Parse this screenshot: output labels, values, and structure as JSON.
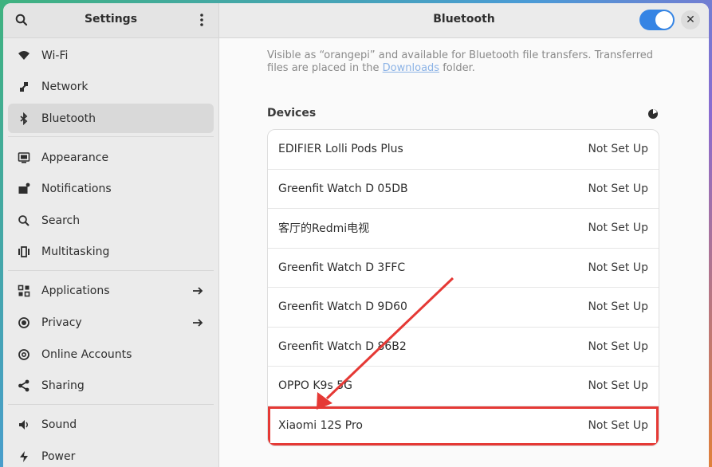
{
  "sidebar": {
    "title": "Settings",
    "items": [
      {
        "label": "Wi-Fi",
        "icon": "wifi-icon"
      },
      {
        "label": "Network",
        "icon": "network-icon"
      },
      {
        "label": "Bluetooth",
        "icon": "bluetooth-icon",
        "active": true
      },
      {
        "label": "Appearance",
        "icon": "appearance-icon"
      },
      {
        "label": "Notifications",
        "icon": "notifications-icon"
      },
      {
        "label": "Search",
        "icon": "search-icon"
      },
      {
        "label": "Multitasking",
        "icon": "multitasking-icon"
      },
      {
        "label": "Applications",
        "icon": "applications-icon"
      },
      {
        "label": "Privacy",
        "icon": "privacy-icon"
      },
      {
        "label": "Online Accounts",
        "icon": "online-accounts-icon"
      },
      {
        "label": "Sharing",
        "icon": "sharing-icon"
      },
      {
        "label": "Sound",
        "icon": "sound-icon"
      },
      {
        "label": "Power",
        "icon": "power-icon"
      }
    ]
  },
  "main": {
    "title": "Bluetooth",
    "toggle_on": true,
    "visible_prefix": "Visible as “orangepi” and available for Bluetooth file transfers. Transferred files are placed in the ",
    "downloads_link": "Downloads",
    "visible_suffix": " folder.",
    "devices_label": "Devices",
    "devices": [
      {
        "name": "EDIFIER Lolli Pods Plus",
        "status": "Not Set Up"
      },
      {
        "name": "Greenfit Watch D 05DB",
        "status": "Not Set Up"
      },
      {
        "name": "客厅的Redmi电视",
        "status": "Not Set Up"
      },
      {
        "name": "Greenfit Watch D 3FFC",
        "status": "Not Set Up"
      },
      {
        "name": "Greenfit Watch D 9D60",
        "status": "Not Set Up"
      },
      {
        "name": "Greenfit Watch D 86B2",
        "status": "Not Set Up"
      },
      {
        "name": "OPPO K9s 5G",
        "status": "Not Set Up"
      },
      {
        "name": "Xiaomi 12S Pro",
        "status": "Not Set Up"
      }
    ]
  },
  "colors": {
    "accent": "#3584e4",
    "annotation": "#e53935"
  }
}
